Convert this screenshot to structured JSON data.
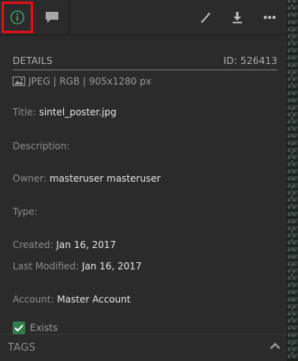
{
  "toolbar": {
    "tabs": [
      {
        "icon": "info-icon",
        "selected": true
      },
      {
        "icon": "comment-icon",
        "selected": false
      }
    ],
    "tools": [
      "edit-icon",
      "download-icon",
      "more-icon"
    ]
  },
  "details": {
    "header": "DETAILS",
    "id_text": "ID: 526413",
    "file_info": "JPEG | RGB | 905x1280 px",
    "fields": [
      {
        "label": "Title:",
        "value": "sintel_poster.jpg"
      },
      {
        "label": "Description:",
        "value": ""
      },
      {
        "label": "Owner:",
        "value": "masteruser masteruser"
      },
      {
        "label": "Type:",
        "value": ""
      },
      {
        "label": "Created:",
        "value": "Jan 16, 2017"
      },
      {
        "label": "Last Modified:",
        "value": "Jan 16, 2017"
      },
      {
        "label": "Account:",
        "value": "Master Account"
      }
    ],
    "exists_label": "Exists",
    "exists_checked": true
  },
  "tags": {
    "label": "TAGS"
  },
  "colors": {
    "panel": "#2b2b2b",
    "accent_green": "#2f7d4d",
    "highlight_red": "#e3101a"
  }
}
